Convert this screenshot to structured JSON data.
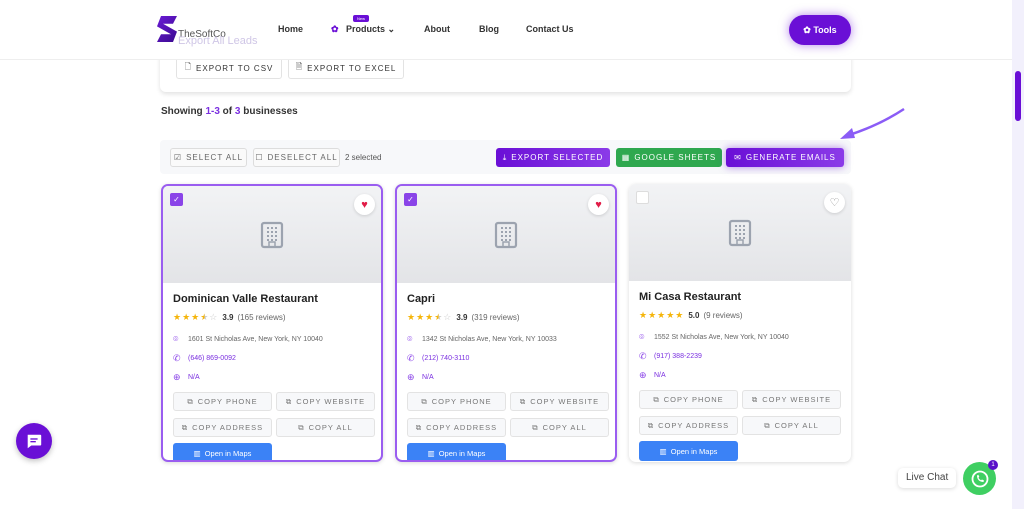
{
  "header": {
    "logo": "TheSoftCo",
    "nav": [
      "Home",
      "Products",
      "About",
      "Blog",
      "Contact Us"
    ],
    "new_badge": "New",
    "tools": "Tools",
    "ghost_text": "Export All Leads"
  },
  "export": {
    "csv": "EXPORT TO CSV",
    "excel": "EXPORT TO EXCEL"
  },
  "showing": {
    "prefix": "Showing ",
    "range": "1-3",
    "of": " of ",
    "total": "3",
    "suffix": " businesses"
  },
  "toolbar": {
    "select_all": "SELECT ALL",
    "deselect_all": "DESELECT ALL",
    "selected": "2 selected",
    "export_selected": "EXPORT SELECTED",
    "google_sheets": "GOOGLE SHEETS",
    "generate_emails": "GENERATE EMAILS"
  },
  "colors": {
    "accent": "#6a0fd6",
    "green": "#2fa84f",
    "maps": "#3b82f6",
    "star": "#f5b50a"
  },
  "card_labels": {
    "copy_phone": "COPY PHONE",
    "copy_website": "COPY WEBSITE",
    "copy_address": "COPY ADDRESS",
    "copy_all": "COPY ALL",
    "open_maps": "Open in Maps"
  },
  "businesses": [
    {
      "name": "Dominican Valle Restaurant",
      "rating": "3.9",
      "stars": 3.5,
      "reviews": "(165 reviews)",
      "address": "1601 St Nicholas Ave, New York, NY 10040",
      "phone": "(646) 869-0092",
      "website": "N/A",
      "selected": true,
      "favorite": true
    },
    {
      "name": "Capri",
      "rating": "3.9",
      "stars": 3.5,
      "reviews": "(319 reviews)",
      "address": "1342 St Nicholas Ave, New York, NY 10033",
      "phone": "(212) 740-3110",
      "website": "N/A",
      "selected": true,
      "favorite": true
    },
    {
      "name": "Mi Casa Restaurant",
      "rating": "5.0",
      "stars": 5,
      "reviews": "(9 reviews)",
      "address": "1552 St Nicholas Ave, New York, NY 10040",
      "phone": "(917) 388-2239",
      "website": "N/A",
      "selected": false,
      "favorite": false
    }
  ],
  "chat": {
    "live_chat": "Live Chat",
    "badge": "1"
  }
}
